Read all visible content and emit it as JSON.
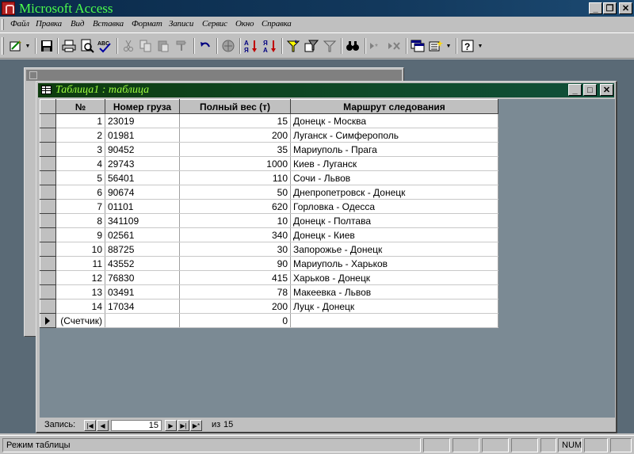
{
  "app": {
    "title": "Microsoft Access",
    "title_color": "#4cff4c"
  },
  "menu": {
    "items": [
      "Файл",
      "Правка",
      "Вид",
      "Вставка",
      "Формат",
      "Записи",
      "Сервис",
      "Окно",
      "Справка"
    ]
  },
  "toolbar": {
    "icons": [
      "design-view-icon",
      "save-icon",
      "print-icon",
      "print-preview-icon",
      "spelling-icon",
      "cut-icon",
      "copy-icon",
      "paste-icon",
      "format-painter-icon",
      "undo-icon",
      "hyperlink-icon",
      "sort-ascending-icon",
      "sort-descending-icon",
      "filter-by-selection-icon",
      "filter-by-form-icon",
      "apply-filter-icon",
      "find-icon",
      "new-record-icon",
      "delete-record-icon",
      "database-window-icon",
      "new-object-icon",
      "help-icon"
    ]
  },
  "table_window": {
    "title": "Таблица1 : таблица",
    "title_color": "#9fff3f",
    "columns": [
      "№",
      "Номер груза",
      "Полный вес (т)",
      "Маршрут следования"
    ],
    "rows": [
      {
        "id": "1",
        "cargo": "23019",
        "weight": "15",
        "route": "Донецк - Москва"
      },
      {
        "id": "2",
        "cargo": "01981",
        "weight": "200",
        "route": "Луганск - Симферополь"
      },
      {
        "id": "3",
        "cargo": "90452",
        "weight": "35",
        "route": "Мариуполь - Прага"
      },
      {
        "id": "4",
        "cargo": "29743",
        "weight": "1000",
        "route": "Киев - Луганск"
      },
      {
        "id": "5",
        "cargo": "56401",
        "weight": "110",
        "route": "Сочи - Львов"
      },
      {
        "id": "6",
        "cargo": "90674",
        "weight": "50",
        "route": "Днепропетровск - Донецк"
      },
      {
        "id": "7",
        "cargo": "01101",
        "weight": "620",
        "route": "Горловка - Одесса"
      },
      {
        "id": "8",
        "cargo": "341109",
        "weight": "10",
        "route": "Донецк - Полтава"
      },
      {
        "id": "9",
        "cargo": "02561",
        "weight": "340",
        "route": "Донецк - Киев"
      },
      {
        "id": "10",
        "cargo": "88725",
        "weight": "30",
        "route": "Запорожье - Донецк"
      },
      {
        "id": "11",
        "cargo": "43552",
        "weight": "90",
        "route": "Мариуполь - Харьков"
      },
      {
        "id": "12",
        "cargo": "76830",
        "weight": "415",
        "route": "Харьков - Донецк"
      },
      {
        "id": "13",
        "cargo": "03491",
        "weight": "78",
        "route": "Макеевка - Львов"
      },
      {
        "id": "14",
        "cargo": "17034",
        "weight": "200",
        "route": "Луцк - Донецк"
      }
    ],
    "new_row": {
      "id": "(Счетчик)",
      "cargo": "",
      "weight": "0",
      "route": ""
    }
  },
  "navigation": {
    "label": "Запись:",
    "current": "15",
    "of_label": "из",
    "total": "15"
  },
  "status": {
    "mode": "Режим таблицы",
    "num": "NUM"
  }
}
